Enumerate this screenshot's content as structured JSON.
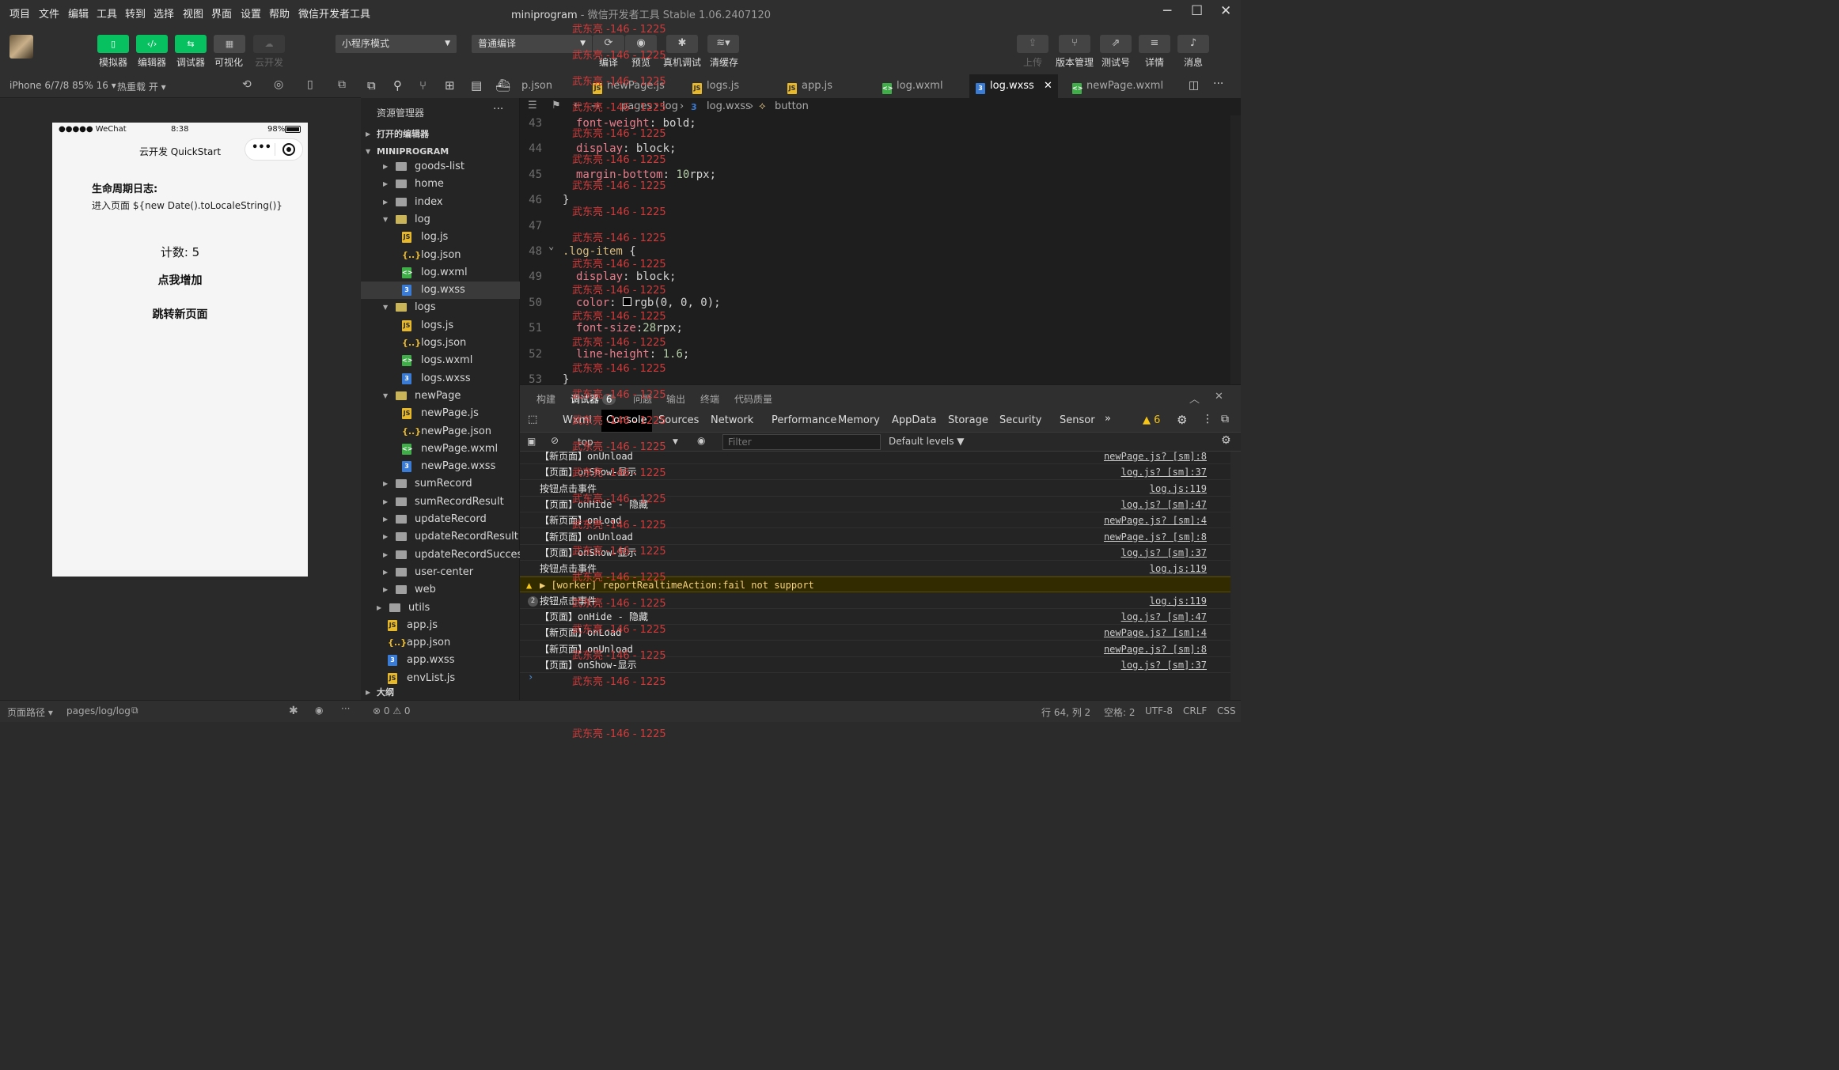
{
  "menu": {
    "items": [
      "项目",
      "文件",
      "编辑",
      "工具",
      "转到",
      "选择",
      "视图",
      "界面",
      "设置",
      "帮助",
      "微信开发者工具"
    ]
  },
  "window": {
    "title": "miniprogram",
    "subtitle": " - 微信开发者工具 Stable 1.06.2407120"
  },
  "toolbar": {
    "simulator": "模拟器",
    "editor": "编辑器",
    "debugger": "调试器",
    "visual": "可视化",
    "cloud": "云开发",
    "mode": "小程序模式",
    "compile_mode": "普通编译",
    "compile": "编译",
    "preview": "预览",
    "realdevice": "真机调试",
    "clearcache": "清缓存",
    "upload": "上传",
    "version": "版本管理",
    "test": "测试号",
    "detail": "详情",
    "message": "消息"
  },
  "device": {
    "model": "iPhone 6/7/8 85% 16",
    "hotreload": "热重载 开"
  },
  "phone": {
    "carrier": "●●●●● WeChat",
    "time": "8:38",
    "battery": "98%",
    "nav_title": "云开发 QuickStart",
    "log_title": "生命周期日志:",
    "log_text": "进入页面 ${new Date().toLocaleString()}",
    "count": "计数: 5",
    "btn_increase": "点我增加",
    "btn_navigate": "跳转新页面"
  },
  "explorer": {
    "title": "资源管理器",
    "open_editors": "打开的编辑器",
    "root": "MINIPROGRAM",
    "outline": "大纲",
    "items": [
      "goods-list",
      "home",
      "index",
      "log",
      "log.js",
      "log.json",
      "log.wxml",
      "log.wxss",
      "logs",
      "logs.js",
      "logs.json",
      "logs.wxml",
      "logs.wxss",
      "newPage",
      "newPage.js",
      "newPage.json",
      "newPage.wxml",
      "newPage.wxss",
      "sumRecord",
      "sumRecordResult",
      "updateRecord",
      "updateRecordResult",
      "updateRecordSuccess",
      "user-center",
      "web",
      "utils",
      "app.js",
      "app.json",
      "app.wxss",
      "envList.js"
    ]
  },
  "tabs": [
    "p.json",
    "newPage.js",
    "logs.js",
    "app.js",
    "log.wxml",
    "log.wxss",
    "newPage.wxml"
  ],
  "breadcrumb": {
    "a": "pages",
    "b": "log",
    "c": "log.wxss",
    "d": "button"
  },
  "code": {
    "lines": [
      "43",
      "44",
      "45",
      "46",
      "47",
      "48",
      "49",
      "50",
      "51",
      "52",
      "53"
    ],
    "l43": "font-weight",
    "l43v": " bold;",
    "l44": "display",
    "l44v": " block;",
    "l45": "margin-bottom",
    "l45n": " 10",
    "l45v": "rpx;",
    "l46": "}",
    "l48": ".log-item",
    "l48b": " {",
    "l49": "display",
    "l49v": " block;",
    "l50": "color",
    "l50v": "rgb(0, 0, 0);",
    "l51": "font-size",
    "l51n": "28",
    "l51v": "rpx;",
    "l52": "line-height",
    "l52n": " 1.6",
    "l52v": ";",
    "l53": "}"
  },
  "watermark": "武东亮 -146 - 1225",
  "panel": {
    "build": "构建",
    "debugger": "调试器",
    "badge": "6",
    "issues": "问题",
    "output": "输出",
    "terminal": "终端",
    "quality": "代码质量"
  },
  "devtools": {
    "tabs": [
      "Wxml",
      "Console",
      "Sources",
      "Network",
      "Performance",
      "Memory",
      "AppData",
      "Storage",
      "Security",
      "Sensor"
    ],
    "more": "»",
    "warn_count": "▲ 6",
    "context": "top",
    "filter_placeholder": "Filter",
    "levels": "Default levels ▼"
  },
  "console": [
    {
      "t": "【新页面】onUnload",
      "s": "newPage.js? [sm]:8"
    },
    {
      "t": "【页面】onShow-显示",
      "s": "log.js? [sm]:37"
    },
    {
      "t": "按钮点击事件",
      "s": "log.js:119"
    },
    {
      "t": "【页面】onHide - 隐藏",
      "s": "log.js? [sm]:47"
    },
    {
      "t": "【新页面】onLoad",
      "s": "newPage.js? [sm]:4"
    },
    {
      "t": "【新页面】onUnload",
      "s": "newPage.js? [sm]:8"
    },
    {
      "t": "【页面】onShow-显示",
      "s": "log.js? [sm]:37"
    },
    {
      "t": "按钮点击事件",
      "s": "log.js:119"
    },
    {
      "t": "▶ [worker] reportRealtimeAction:fail not support",
      "s": ""
    },
    {
      "t": "按钮点击事件",
      "s": "log.js:119"
    },
    {
      "t": "【页面】onHide - 隐藏",
      "s": "log.js? [sm]:47"
    },
    {
      "t": "【新页面】onLoad",
      "s": "newPage.js? [sm]:4"
    },
    {
      "t": "【新页面】onUnload",
      "s": "newPage.js? [sm]:8"
    },
    {
      "t": "【页面】onShow-显示",
      "s": "log.js? [sm]:37"
    }
  ],
  "repeat_badge": "2",
  "status": {
    "path_label": "页面路径 ▾",
    "path": "pages/log/log",
    "errors": "⊗ 0 ⚠ 0",
    "pos": "行 64, 列 2",
    "indent": "空格: 2",
    "enc": "UTF-8",
    "eol": "CRLF",
    "lang": "CSS"
  }
}
